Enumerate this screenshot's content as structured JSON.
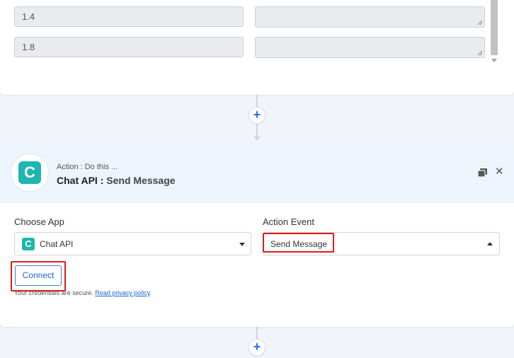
{
  "values": {
    "row1": "1.4",
    "row2": "1.8"
  },
  "action": {
    "subtitle": "Action : Do this ...",
    "app_name": "Chat API :",
    "event_name": "Send Message",
    "logo_letter": "C"
  },
  "form": {
    "choose_app_label": "Choose App",
    "choose_app_value": "Chat API",
    "action_event_label": "Action Event",
    "action_event_value": "Send Message",
    "connect_label": "Connect",
    "credentials_text": "Your credentials are secure.",
    "privacy_link": "Read privacy policy",
    "credentials_end": "."
  },
  "buttons": {
    "add_step": "+"
  },
  "icons": {
    "copy": "copy-icon",
    "close": "close-icon",
    "close_glyph": "✕",
    "dropdown": "chevron-down-icon"
  },
  "colors": {
    "accent": "#1e73e8",
    "brand_teal": "#1fb6b0",
    "highlight_red": "#e21b1b",
    "header_bg": "#edf4fb"
  }
}
